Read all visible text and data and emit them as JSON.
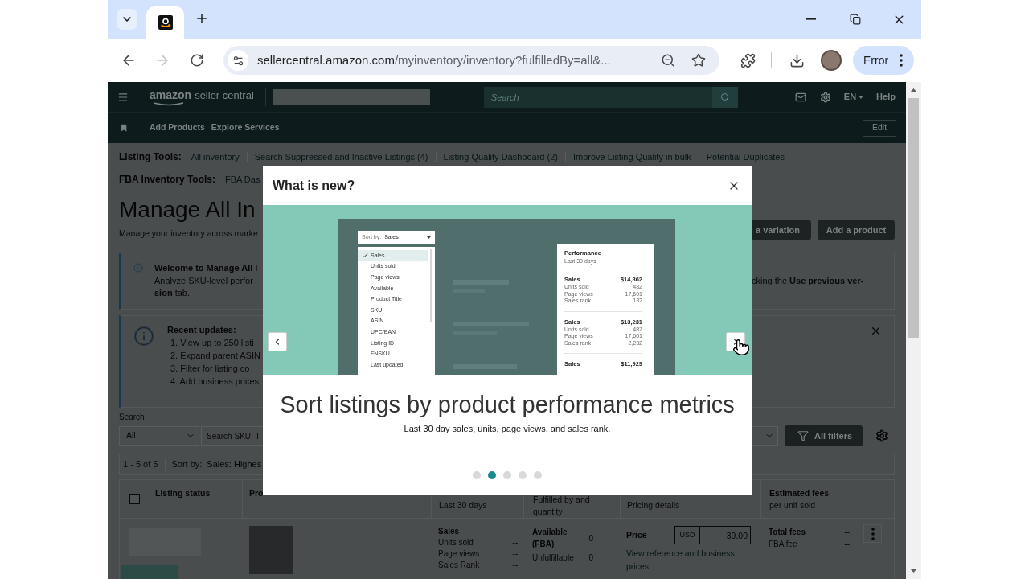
{
  "browser": {
    "tabs": [
      {
        "selected": true
      }
    ],
    "url": {
      "host": "sellercentral.amazon.com",
      "path": "/myinventory/inventory?fulfilledBy=all&..."
    },
    "forward_disabled": true,
    "profile_status": "Error"
  },
  "header": {
    "logo": {
      "brand": "amazon",
      "product": "seller central"
    },
    "search_placeholder": "Search",
    "language": "EN",
    "help": "Help"
  },
  "nav": {
    "links": [
      "Add Products",
      "Explore Services"
    ],
    "edit_button": "Edit"
  },
  "listing_tools": {
    "label": "Listing Tools:",
    "links": [
      "All inventory",
      "Search Suppressed and Inactive Listings (4)",
      "Listing Quality Dashboard (2)",
      "Improve Listing Quality in bulk",
      "Potential Duplicates"
    ]
  },
  "fba_tools": {
    "label": "FBA Inventory Tools:",
    "links": [
      "FBA Das"
    ]
  },
  "page": {
    "title": "Manage All In",
    "subtitle": "Manage your inventory across marke",
    "buttons": [
      "a variation",
      "Add a product"
    ]
  },
  "welcome_alert": {
    "title": "Welcome to Manage All I",
    "lines": [
      "Analyze SKU-level perfor",
      "**sion** tab."
    ],
    "right_text": "cking the **Use previous ver-**"
  },
  "updates_alert": {
    "title": "Recent updates:",
    "items": [
      "1. View up to 250 listi",
      "2. Expand parent ASIN",
      "3. Filter for listing co",
      "4. Add business prices"
    ]
  },
  "search": {
    "label": "Search",
    "scope": "All",
    "placeholder": "Search SKU, T",
    "filters_button": "All filters"
  },
  "results": {
    "count": "1 - 5 of 5",
    "sort_label": "Sort by:",
    "sort_value": "Sales: Highes"
  },
  "table": {
    "select_all": {
      "checked": false
    },
    "columns": [
      {
        "title": "Listing status"
      },
      {
        "title": "Pro"
      },
      {
        "subtitle": "Last 30 days"
      },
      {
        "subtitle": "Fulfilled by and quantity"
      },
      {
        "subtitle": "Pricing details"
      },
      {
        "title": "Estimated fees",
        "subtitle": "per unit sold"
      }
    ],
    "row": {
      "sales": [
        {
          "kind": "primary",
          "label": "Sales",
          "value": "--"
        },
        {
          "kind": "secondary",
          "label": "Units sold",
          "value": "--"
        },
        {
          "kind": "secondary",
          "label": "Page views",
          "value": "--"
        },
        {
          "kind": "secondary",
          "label": "Sales Rank",
          "value": "--"
        }
      ],
      "inventory": [
        {
          "kind": "primary",
          "label": "Available (FBA)",
          "value": "0"
        },
        {
          "kind": "secondary",
          "label": "Unfulfillable",
          "value": "0"
        }
      ],
      "price": {
        "label": "Price",
        "currency": "USD",
        "value": "39.00",
        "link": "View reference and business prices"
      },
      "fees": [
        {
          "kind": "primary",
          "label": "Total fees",
          "value": "--"
        },
        {
          "kind": "secondary",
          "label": "FBA fee",
          "value": "--"
        }
      ]
    }
  },
  "modal": {
    "title": "What is new?",
    "slide": {
      "sort_label": "Sort by:",
      "sort_value": "Sales",
      "options": [
        {
          "label": "Sales",
          "selected": true
        },
        {
          "label": "Units sold",
          "selected": false
        },
        {
          "label": "Page views",
          "selected": false
        },
        {
          "label": "Available",
          "selected": false
        },
        {
          "label": "Product Title",
          "selected": false
        },
        {
          "label": "SKU",
          "selected": false
        },
        {
          "label": "ASIN",
          "selected": false
        },
        {
          "label": "UPC/EAN",
          "selected": false
        },
        {
          "label": "Listing ID",
          "selected": false
        },
        {
          "label": "FNSKU",
          "selected": false
        },
        {
          "label": "Last updated",
          "selected": false
        }
      ],
      "card": {
        "title": "Performance",
        "period": "Last 30 days",
        "groups": [
          {
            "label": "Sales",
            "value": "$14,862",
            "stats": [
              {
                "label": "Units sold",
                "value": "482"
              },
              {
                "label": "Page views",
                "value": "17,601"
              },
              {
                "label": "Sales rank",
                "value": "132"
              }
            ]
          },
          {
            "label": "Sales",
            "value": "$13,231",
            "stats": [
              {
                "label": "Units sold",
                "value": "487"
              },
              {
                "label": "Page views",
                "value": "17,601"
              },
              {
                "label": "Sales rank",
                "value": "2,232"
              }
            ]
          },
          {
            "label": "Sales",
            "value": "$11,929"
          }
        ]
      }
    },
    "heading": "Sort listings by product performance metrics",
    "text": "Last 30 day sales, units, page views, and sales rank.",
    "dots": [
      {
        "selected": false
      },
      {
        "selected": true
      },
      {
        "selected": false
      },
      {
        "selected": false
      },
      {
        "selected": false
      }
    ]
  }
}
